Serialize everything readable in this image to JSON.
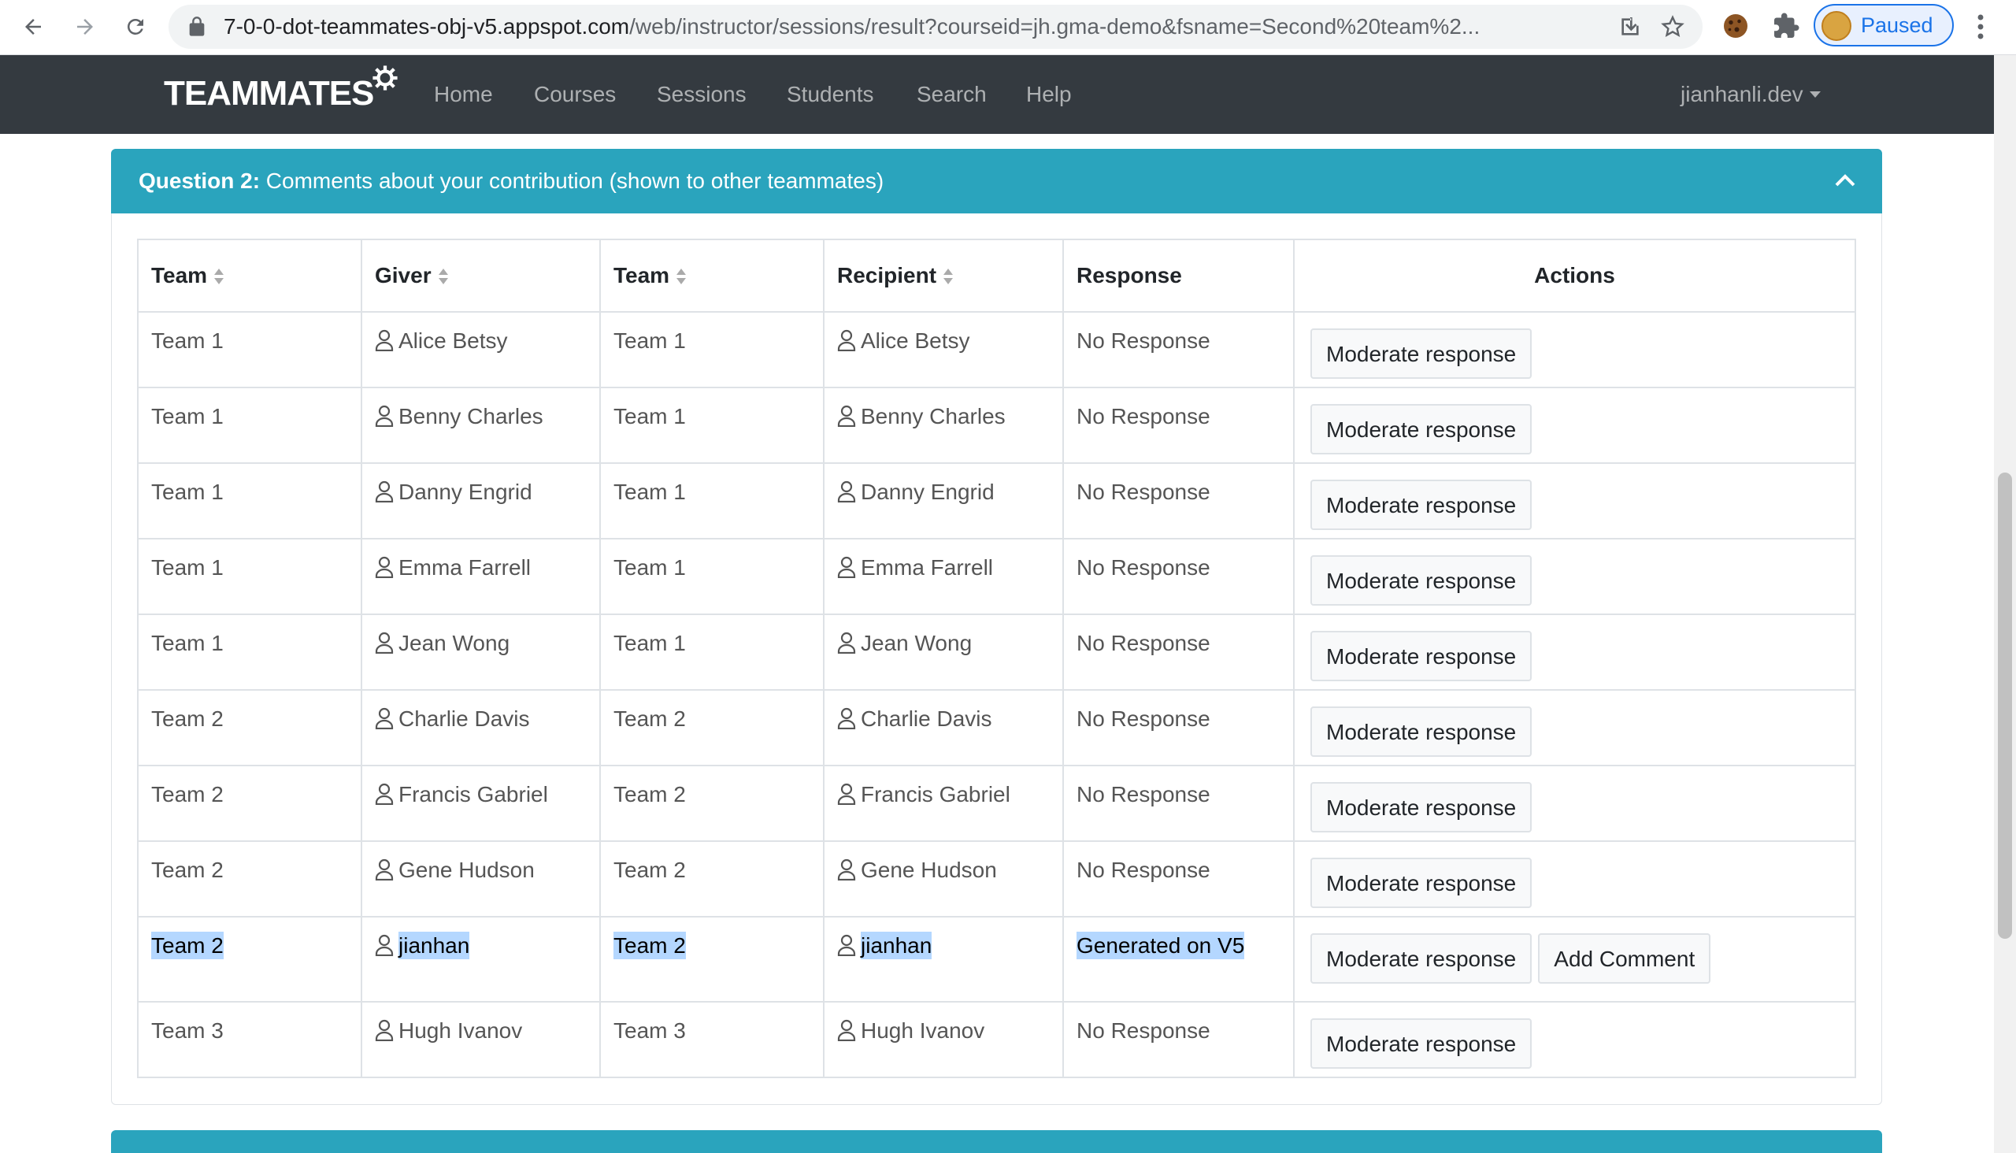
{
  "browser": {
    "url_host": "7-0-0-dot-teammates-obj-v5.appspot.com",
    "url_path": "/web/instructor/sessions/result?courseid=jh.gma-demo&fsname=Second%20team%2...",
    "profile_label": "Paused"
  },
  "navbar": {
    "brand": "TEAMMATES",
    "links": [
      "Home",
      "Courses",
      "Sessions",
      "Students",
      "Search",
      "Help"
    ],
    "user": "jianhanli.dev"
  },
  "question": {
    "label": "Question 2:",
    "text": "Comments about your contribution (shown to other teammates)"
  },
  "table": {
    "headers": [
      "Team",
      "Giver",
      "Team",
      "Recipient",
      "Response",
      "Actions"
    ],
    "rows": [
      {
        "giver_team": "Team 1",
        "giver": "Alice Betsy",
        "recipient_team": "Team 1",
        "recipient": "Alice Betsy",
        "response": "No Response"
      },
      {
        "giver_team": "Team 1",
        "giver": "Benny Charles",
        "recipient_team": "Team 1",
        "recipient": "Benny Charles",
        "response": "No Response"
      },
      {
        "giver_team": "Team 1",
        "giver": "Danny Engrid",
        "recipient_team": "Team 1",
        "recipient": "Danny Engrid",
        "response": "No Response"
      },
      {
        "giver_team": "Team 1",
        "giver": "Emma Farrell",
        "recipient_team": "Team 1",
        "recipient": "Emma Farrell",
        "response": "No Response"
      },
      {
        "giver_team": "Team 1",
        "giver": "Jean Wong",
        "recipient_team": "Team 1",
        "recipient": "Jean Wong",
        "response": "No Response"
      },
      {
        "giver_team": "Team 2",
        "giver": "Charlie Davis",
        "recipient_team": "Team 2",
        "recipient": "Charlie Davis",
        "response": "No Response"
      },
      {
        "giver_team": "Team 2",
        "giver": "Francis Gabriel",
        "recipient_team": "Team 2",
        "recipient": "Francis Gabriel",
        "response": "No Response"
      },
      {
        "giver_team": "Team 2",
        "giver": "Gene Hudson",
        "recipient_team": "Team 2",
        "recipient": "Gene Hudson",
        "response": "No Response"
      },
      {
        "giver_team": "Team 2",
        "giver": "jianhan",
        "recipient_team": "Team 2",
        "recipient": "jianhan",
        "response": "Generated on V5"
      },
      {
        "giver_team": "Team 3",
        "giver": "Hugh Ivanov",
        "recipient_team": "Team 3",
        "recipient": "Hugh Ivanov",
        "response": "No Response"
      }
    ],
    "moderate_label": "Moderate response",
    "add_comment_label": "Add Comment"
  },
  "colors": {
    "navbar": "#343a40",
    "card_header": "#2aa4bd",
    "selection": "#b4d7ff"
  }
}
